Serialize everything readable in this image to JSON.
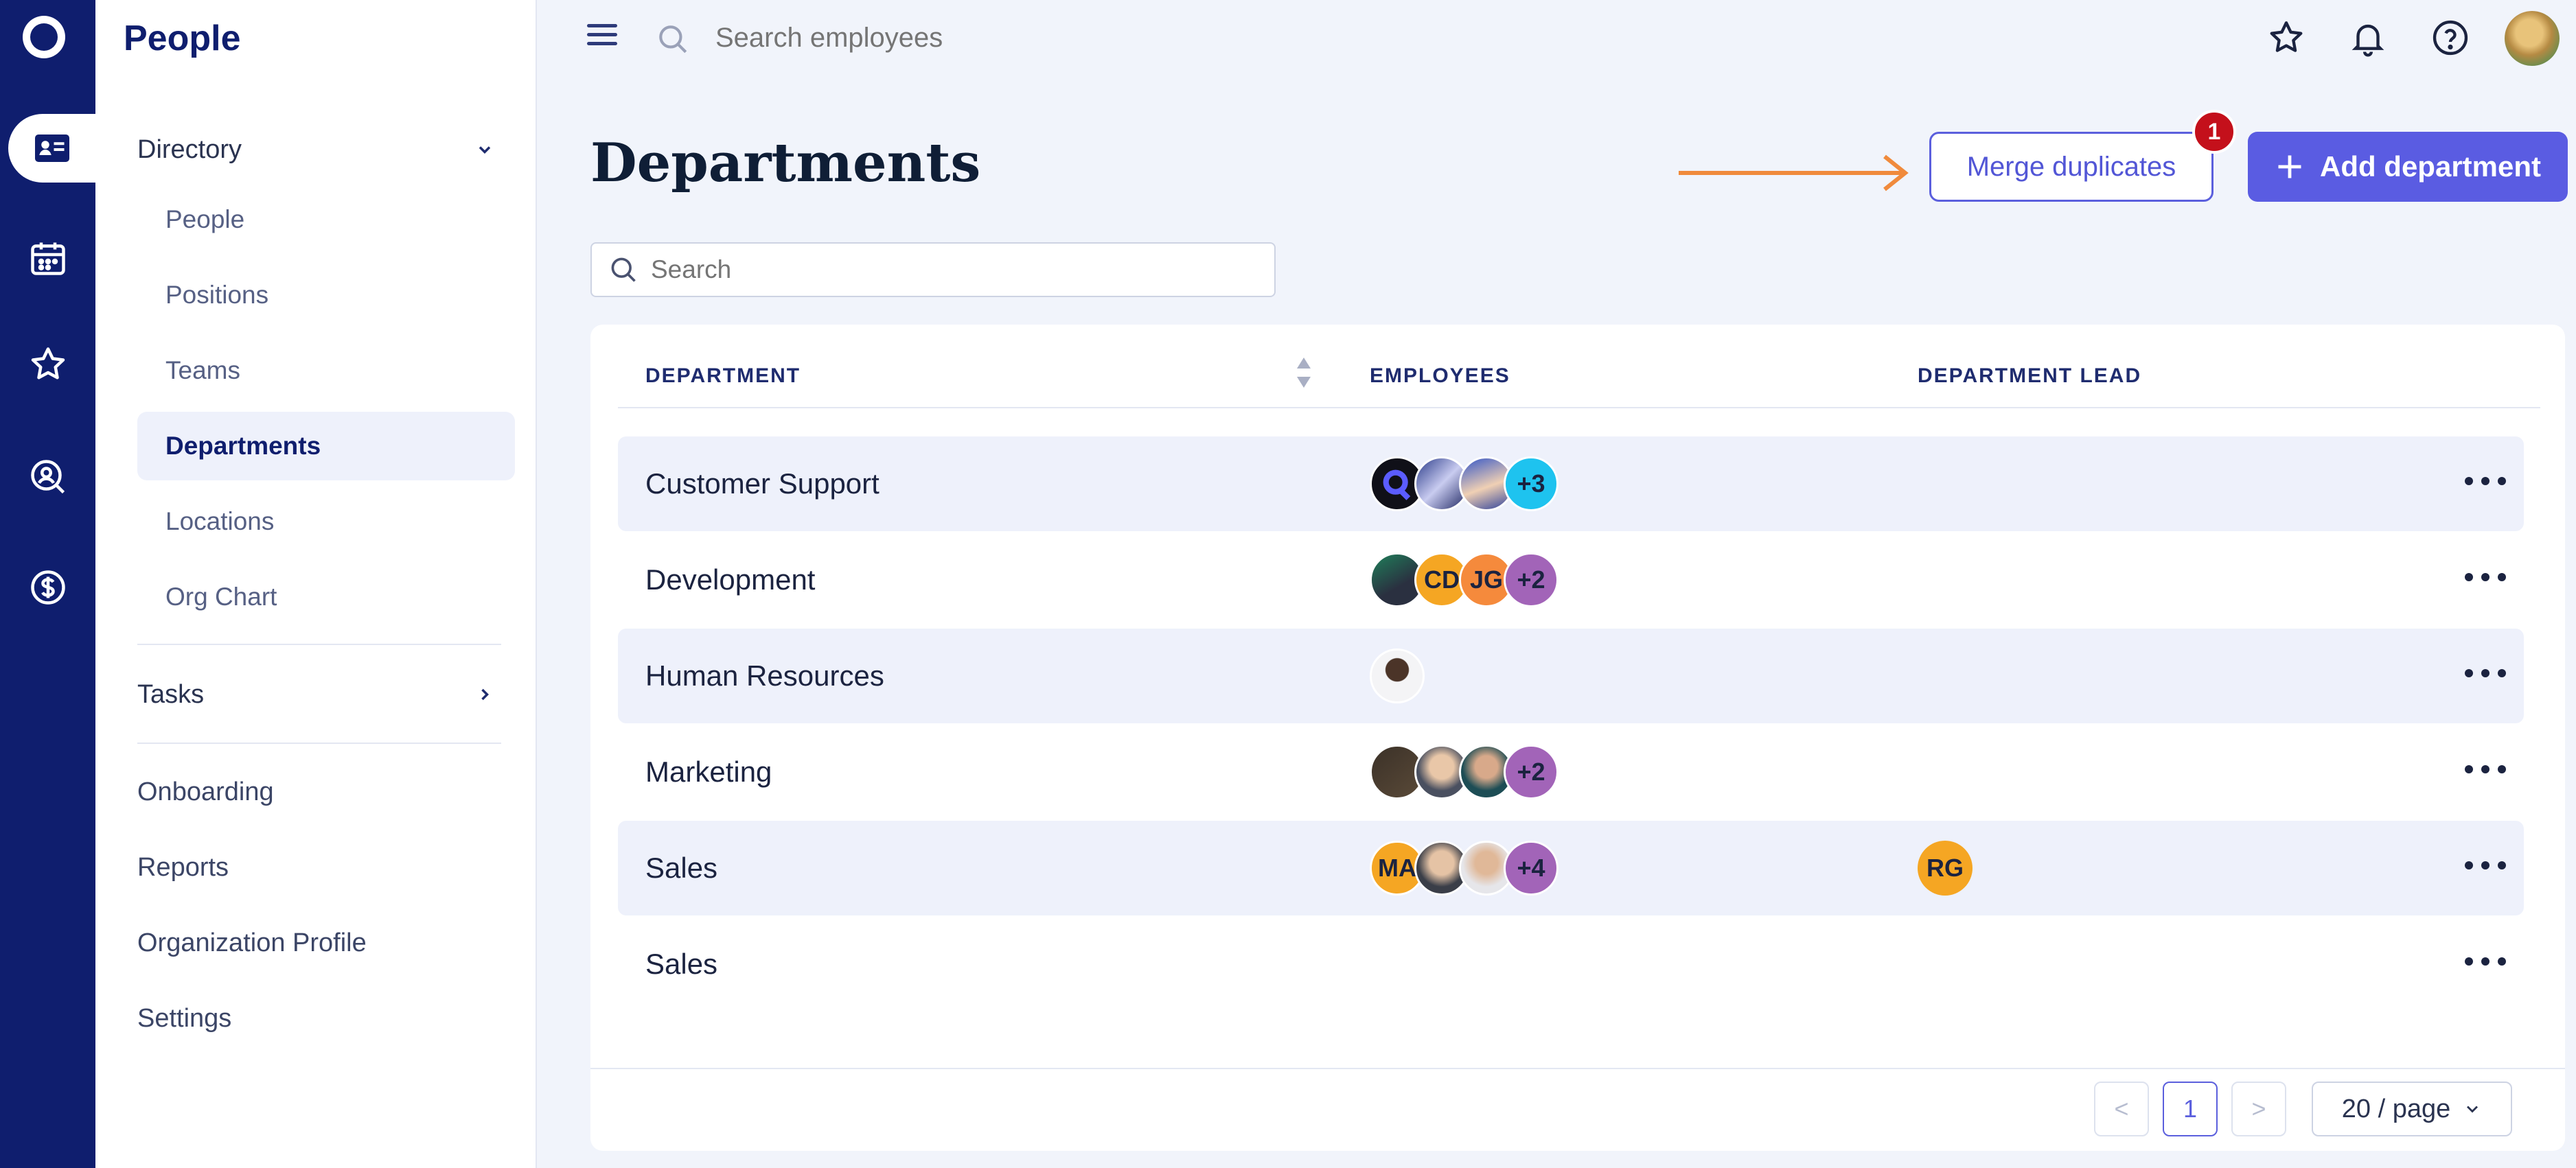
{
  "rail": {
    "items": [
      {
        "icon": "id-card-icon",
        "active": true
      },
      {
        "icon": "calendar-icon",
        "active": false
      },
      {
        "icon": "star-icon",
        "active": false
      },
      {
        "icon": "search-person-icon",
        "active": false
      },
      {
        "icon": "dollar-icon",
        "active": false
      }
    ]
  },
  "sidenav": {
    "app_title": "People",
    "directory": {
      "label": "Directory",
      "items": [
        "People",
        "Positions",
        "Teams",
        "Departments",
        "Locations",
        "Org Chart"
      ],
      "active": "Departments"
    },
    "tasks_label": "Tasks",
    "links": [
      "Onboarding",
      "Reports",
      "Organization Profile",
      "Settings"
    ]
  },
  "topbar": {
    "search_placeholder": "Search employees",
    "icons": [
      "star-icon",
      "bell-icon",
      "help-icon",
      "user-avatar"
    ]
  },
  "page": {
    "title": "Departments",
    "merge_label": "Merge duplicates",
    "merge_badge": "1",
    "add_label": "Add department",
    "search_placeholder": "Search"
  },
  "table": {
    "columns": [
      "DEPARTMENT",
      "EMPLOYEES",
      "DEPARTMENT LEAD"
    ],
    "rows": [
      {
        "name": "Customer Support",
        "avatars": [
          "photo",
          "photo",
          "photo"
        ],
        "more": "+3",
        "lead": ""
      },
      {
        "name": "Development",
        "avatars": [
          "photo",
          "CD",
          "JG"
        ],
        "more": "+2",
        "lead": ""
      },
      {
        "name": "Human Resources",
        "avatars": [
          "photo"
        ],
        "more": "",
        "lead": ""
      },
      {
        "name": "Marketing",
        "avatars": [
          "photo",
          "photo",
          "photo"
        ],
        "more": "+2",
        "lead": ""
      },
      {
        "name": "Sales",
        "avatars": [
          "MA",
          "photo",
          "photo"
        ],
        "more": "+4",
        "lead": "RG"
      },
      {
        "name": "Sales",
        "avatars": [],
        "more": "",
        "lead": ""
      }
    ]
  },
  "pagination": {
    "current_page": "1",
    "page_size": "20 / page",
    "prev": "<",
    "next": ">"
  },
  "colors": {
    "rail": "#0f1e6e",
    "accent": "#5a5ce2",
    "badge": "#c4101b",
    "annotation_arrow": "#f08a3c"
  }
}
